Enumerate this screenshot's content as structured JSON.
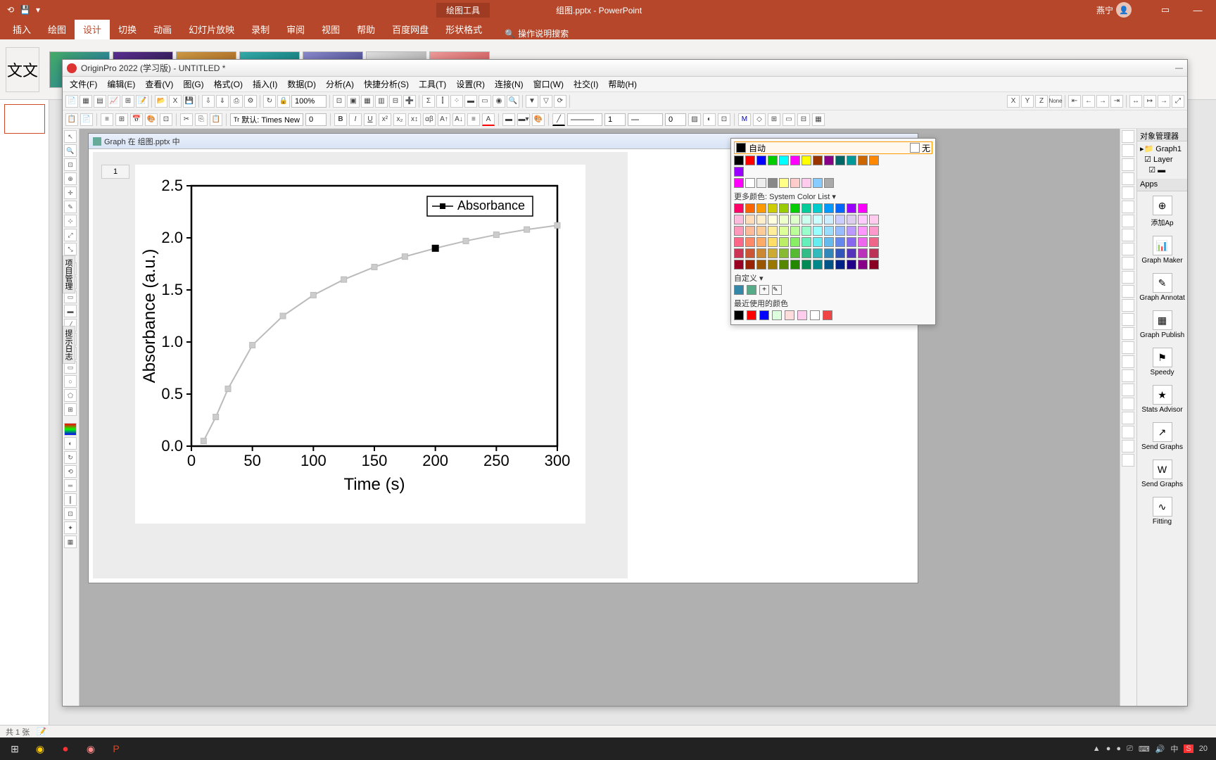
{
  "powerpoint": {
    "context_tab": "绘图工具",
    "doc_title": "组图.pptx - PowerPoint",
    "user": "燕宁",
    "ribbon_tabs": [
      "插入",
      "绘图",
      "设计",
      "切换",
      "动画",
      "幻灯片放映",
      "录制",
      "审阅",
      "视图",
      "帮助",
      "百度网盘",
      "形状格式"
    ],
    "active_tab": "设计",
    "search_hint": "操作说明搜索",
    "theme_label": "文文",
    "status": "共 1 张"
  },
  "origin": {
    "title": "OriginPro 2022 (学习版) - UNTITLED *",
    "menu": [
      "文件(F)",
      "编辑(E)",
      "查看(V)",
      "图(G)",
      "格式(O)",
      "插入(I)",
      "数据(D)",
      "分析(A)",
      "快捷分析(S)",
      "工具(T)",
      "设置(R)",
      "连接(N)",
      "窗口(W)",
      "社交(I)",
      "帮助(H)"
    ],
    "zoom": "100%",
    "font_label": "默认: Times New",
    "size_combo": "0",
    "line_combo1": "1",
    "line_combo2": "0",
    "graph_sub_title": "Graph 在 组图.pptx 中",
    "row_num": "1",
    "obj_mgr_title": "对象管理器",
    "obj_tree": {
      "graph": "Graph1",
      "layer": "Layer"
    },
    "apps_title": "Apps",
    "apps": [
      {
        "icon": "⊕",
        "label": "添加Ap"
      },
      {
        "icon": "📊",
        "label": "Graph Maker"
      },
      {
        "icon": "✎",
        "label": "Graph Annotat"
      },
      {
        "icon": "▦",
        "label": "Graph Publish"
      },
      {
        "icon": "⚑",
        "label": "Speedy"
      },
      {
        "icon": "★",
        "label": "Stats Advisor"
      },
      {
        "icon": "↗",
        "label": "Send Graphs"
      },
      {
        "icon": "W",
        "label": "Send Graphs"
      },
      {
        "icon": "∿",
        "label": "Fitting"
      }
    ],
    "side_label1": "项目管理",
    "side_label2": "提示日志"
  },
  "color_picker": {
    "auto": "自动",
    "none": "无",
    "more": "更多颜色: System Color List",
    "custom": "自定义",
    "recent": "最近使用的颜色",
    "basic": [
      "#000",
      "#f00",
      "#00f",
      "#0c0",
      "#0ff",
      "#f0f",
      "#ff0",
      "#930",
      "#808",
      "#066",
      "#099",
      "#c60",
      "#f80",
      "#90f"
    ],
    "basic2": [
      "#f0f",
      "#fff",
      "#eee",
      "#888",
      "#ff8",
      "#fcc",
      "#fce",
      "#8cf",
      "#aaa"
    ],
    "row3": [
      "#f06",
      "#f60",
      "#f90",
      "#cc0",
      "#9c0",
      "#0c0",
      "#0c9",
      "#0cc",
      "#09f",
      "#06f",
      "#90f",
      "#f0f"
    ],
    "pastel_grid": [
      "#fbd",
      "#fdb",
      "#fec",
      "#ffd",
      "#efc",
      "#dfc",
      "#cfe",
      "#cff",
      "#cef",
      "#ccf",
      "#dce",
      "#fcf",
      "#fce",
      "#f9b",
      "#fb9",
      "#fc9",
      "#fe9",
      "#df9",
      "#bf9",
      "#9fc",
      "#9ff",
      "#9df",
      "#9bf",
      "#b9f",
      "#f9f",
      "#f9c",
      "#f68",
      "#f86",
      "#fa6",
      "#fd6",
      "#be6",
      "#8e6",
      "#6eb",
      "#6ee",
      "#6be",
      "#68e",
      "#86e",
      "#e6e",
      "#e68",
      "#c35",
      "#c53",
      "#c83",
      "#ca3",
      "#8b3",
      "#5b3",
      "#3b8",
      "#3bb",
      "#38b",
      "#35b",
      "#53b",
      "#b3b",
      "#b35",
      "#902",
      "#920",
      "#950",
      "#970",
      "#580",
      "#280",
      "#085",
      "#088",
      "#058",
      "#028",
      "#208",
      "#808",
      "#802"
    ],
    "custom_sw": [
      "#38a",
      "#5a8"
    ],
    "recent_sw": [
      "#000",
      "#f00",
      "#00f",
      "#dfd",
      "#fdd",
      "#fce",
      "#fff",
      "#e44"
    ]
  },
  "chart_data": {
    "type": "line",
    "title": "",
    "xlabel": "Time (s)",
    "ylabel": "Absorbance (a.u.)",
    "xlim": [
      0,
      300
    ],
    "ylim": [
      0.0,
      2.5
    ],
    "xticks": [
      0,
      50,
      100,
      150,
      200,
      250,
      300
    ],
    "yticks": [
      0.0,
      0.5,
      1.0,
      1.5,
      2.0,
      2.5
    ],
    "legend": "Absorbance",
    "series": [
      {
        "name": "Absorbance",
        "x": [
          10,
          20,
          30,
          50,
          75,
          100,
          125,
          150,
          175,
          200,
          225,
          250,
          275,
          300
        ],
        "y": [
          0.05,
          0.28,
          0.55,
          0.97,
          1.25,
          1.45,
          1.6,
          1.72,
          1.82,
          1.9,
          1.97,
          2.03,
          2.08,
          2.12
        ]
      }
    ],
    "highlight_point": {
      "x": 200,
      "y": 1.9
    }
  },
  "taskbar": {
    "tray_items": [
      "▲",
      "●",
      "●",
      "⎚",
      "⌨",
      "🔊",
      "中",
      "S"
    ],
    "time": "20"
  }
}
